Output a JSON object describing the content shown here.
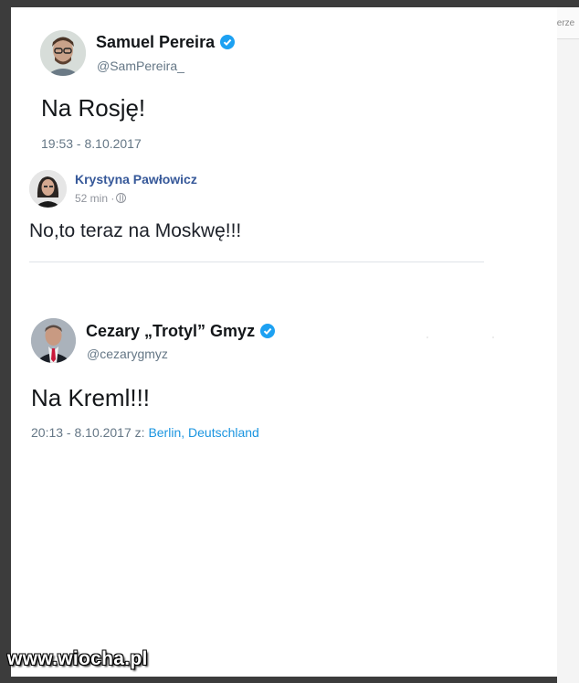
{
  "background_peek_text": "terze",
  "tweet1": {
    "name": "Samuel Pereira",
    "handle": "@SamPereira_",
    "text": "Na Rosję!",
    "meta": "19:53 - 8.10.2017"
  },
  "fb_post": {
    "name": "Krystyna Pawłowicz",
    "time": "52 min ·",
    "text": "No,to teraz na Moskwę!!!"
  },
  "tweet2": {
    "name": "Cezary „Trotyl” Gmyz",
    "handle": "@cezarygmyz",
    "text": "Na Kreml!!!",
    "meta_prefix": "20:13 - 8.10.2017 z: ",
    "location": "Berlin, Deutschland"
  },
  "watermark": "www.wiocha.pl",
  "colors": {
    "verified": "#1da1f2",
    "link": "#1b95e0",
    "fb_name": "#365899"
  }
}
